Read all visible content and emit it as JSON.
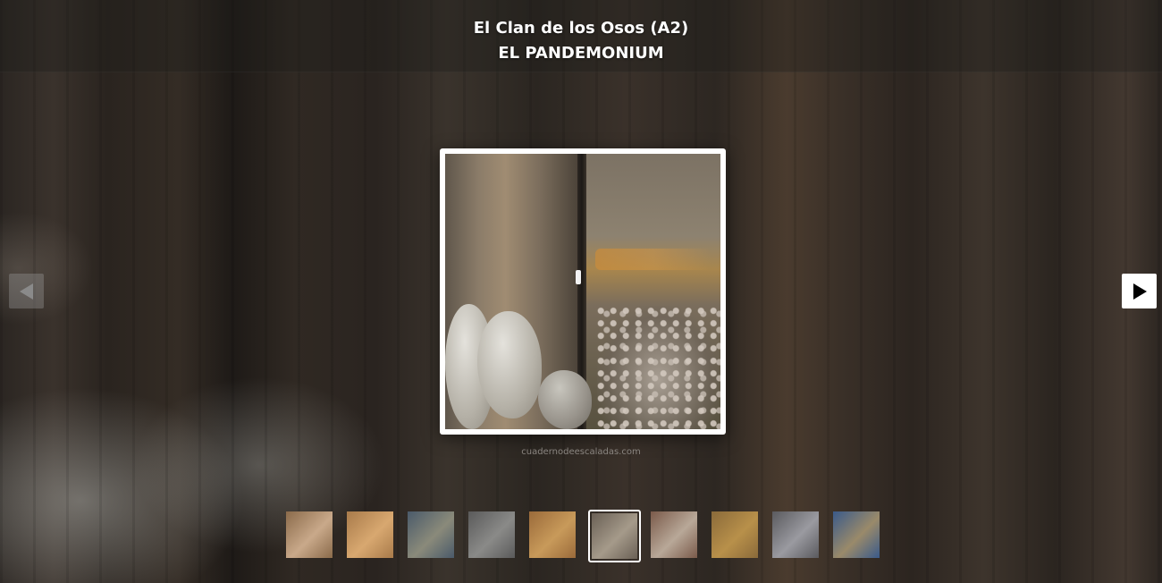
{
  "header": {
    "crag_name": "El Clan de los Osos (A2)",
    "route_name": "EL PANDEMONIUM"
  },
  "navigation": {
    "prev_icon": "triangle-left-icon",
    "next_icon": "triangle-right-icon"
  },
  "photo": {
    "credit": "cuadernodeescaladas.com"
  },
  "thumbnails": {
    "count": 10,
    "active_index": 5,
    "colors": [
      [
        "#8a6a4a",
        "#c9a98a"
      ],
      [
        "#a87a4a",
        "#d8a870"
      ],
      [
        "#4a5a6a",
        "#8a8a7a"
      ],
      [
        "#5a5a5a",
        "#8a8a88"
      ],
      [
        "#9a6a3a",
        "#c89a5a"
      ],
      [
        "#6a6055",
        "#a59a8a"
      ],
      [
        "#7a5a4a",
        "#b8a898"
      ],
      [
        "#8a6a3a",
        "#b8904a"
      ],
      [
        "#5a5a5e",
        "#9a9aa0"
      ],
      [
        "#3a5a8a",
        "#9a8a6a"
      ]
    ]
  }
}
